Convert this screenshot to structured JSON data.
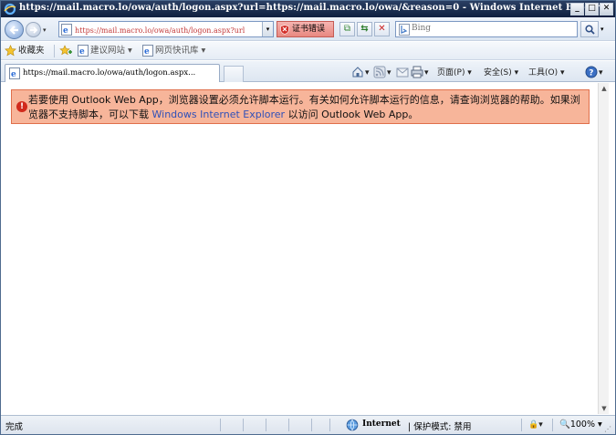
{
  "window": {
    "title": "https://mail.macro.lo/owa/auth/logon.aspx?url=https://mail.macro.lo/owa/&reason=0 - Windows Internet Explorer",
    "minimize_label": "_",
    "maximize_label": "□",
    "close_label": "✕"
  },
  "address": {
    "url": "https://mail.macro.lo/owa/auth/logon.aspx?url",
    "cert_error_label": "证书错误",
    "search_placeholder": "Bing"
  },
  "favorites": {
    "label": "收藏夹",
    "items": [
      {
        "label": "建议网站 ▾",
        "icon": "ie-page-icon"
      },
      {
        "label": "网页快讯库 ▾",
        "icon": "ie-page-icon"
      }
    ]
  },
  "tab": {
    "label": "https://mail.macro.lo/owa/auth/logon.aspx..."
  },
  "command_bar": {
    "page_label": "页面(P) ▾",
    "safety_label": "安全(S) ▾",
    "tools_label": "工具(O) ▾"
  },
  "content": {
    "alert_text_1": "若要使用  Outlook Web App，浏览器设置必须允许脚本运行。有关如何允许脚本运行的信息，请查询浏览器的帮助。如果浏览器不支持脚本，可以下载 ",
    "alert_link": "Windows Internet Explorer",
    "alert_text_2": " 以访问  Outlook Web App。"
  },
  "status": {
    "text": "完成",
    "zone": "Internet",
    "protected_mode": "| 保护模式: 禁用",
    "zoom": "100%"
  },
  "colors": {
    "alert_bg": "#f7b59a",
    "alert_border": "#e06f4b",
    "link": "#3050b8",
    "cert_error_bg": "#e88880"
  }
}
